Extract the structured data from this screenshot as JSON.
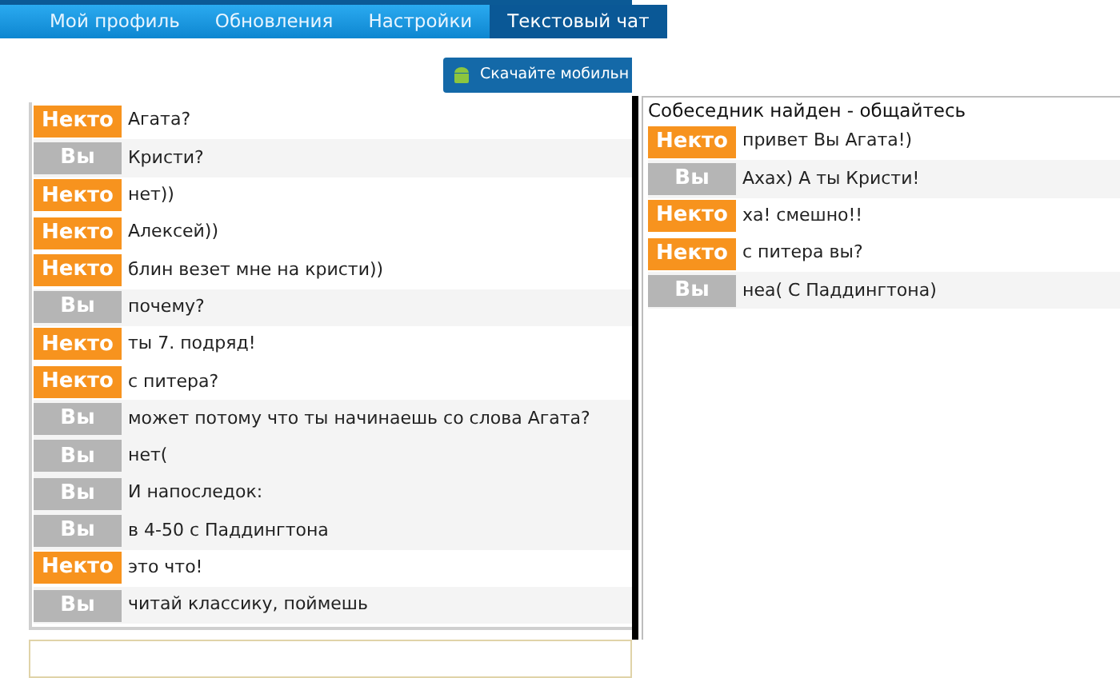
{
  "nav": {
    "tabs": [
      {
        "label": "Мой профиль",
        "selected": false
      },
      {
        "label": "Обновления",
        "selected": false
      },
      {
        "label": "Настройки",
        "selected": false
      },
      {
        "label": "Текстовый чат",
        "selected": true
      }
    ]
  },
  "download_button": {
    "label": "Скачайте мобильн"
  },
  "left_chat": {
    "messages": [
      {
        "kind": "stranger",
        "label": "Некто",
        "text": "Агата?"
      },
      {
        "kind": "me",
        "label": "Вы",
        "text": "Кристи?"
      },
      {
        "kind": "stranger",
        "label": "Некто",
        "text": "нет))"
      },
      {
        "kind": "stranger",
        "label": "Некто",
        "text": "Алексей))"
      },
      {
        "kind": "stranger",
        "label": "Некто",
        "text": "блин везет мне на кристи))"
      },
      {
        "kind": "me",
        "label": "Вы",
        "text": "почему?"
      },
      {
        "kind": "stranger",
        "label": "Некто",
        "text": "ты 7. подряд!"
      },
      {
        "kind": "stranger",
        "label": "Некто",
        "text": "с питера?"
      },
      {
        "kind": "me",
        "label": "Вы",
        "text": "может потому что ты начинаешь со слова Агата?"
      },
      {
        "kind": "me",
        "label": "Вы",
        "text": "нет("
      },
      {
        "kind": "me",
        "label": "Вы",
        "text": "И напоследок:"
      },
      {
        "kind": "me",
        "label": "Вы",
        "text": "в 4-50 с Паддингтона"
      },
      {
        "kind": "stranger",
        "label": "Некто",
        "text": "это что!"
      },
      {
        "kind": "me",
        "label": "Вы",
        "text": "читай классику, поймешь"
      }
    ]
  },
  "right_chat": {
    "status": "Собеседник найден - общайтесь",
    "messages": [
      {
        "kind": "stranger",
        "label": "Некто",
        "text": "привет Вы Агата!)"
      },
      {
        "kind": "me",
        "label": "Вы",
        "text": "Ахах) А ты Кристи!"
      },
      {
        "kind": "stranger",
        "label": "Некто",
        "text": "ха! смешно!!"
      },
      {
        "kind": "stranger",
        "label": "Некто",
        "text": "с питера вы?"
      },
      {
        "kind": "me",
        "label": "Вы",
        "text": "неа( С Паддингтона)"
      }
    ]
  }
}
